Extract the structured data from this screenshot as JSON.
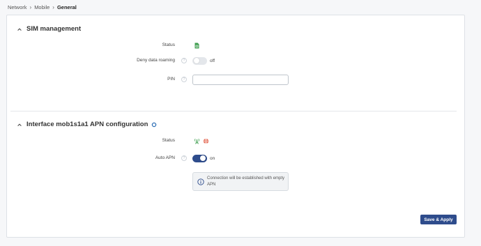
{
  "breadcrumb": {
    "items": [
      "Network",
      "Mobile",
      "General"
    ]
  },
  "sim": {
    "title": "SIM management",
    "status_label": "Status",
    "status_icon": "sim-card-icon",
    "deny_roaming_label": "Deny data roaming",
    "deny_roaming_value": "off",
    "pin_label": "PIN",
    "pin_value": ""
  },
  "apn": {
    "title": "Interface mob1s1a1 APN configuration",
    "status_label": "Status",
    "status_icons": [
      "signal-tower-icon",
      "globe-icon"
    ],
    "auto_apn_label": "Auto APN",
    "auto_apn_value": "on",
    "info_text": "Connection will be established with empty APN"
  },
  "actions": {
    "save_label": "Save & Apply"
  },
  "colors": {
    "accent": "#2e4c8c",
    "sim_green": "#3f9e4f",
    "globe_red": "#e0553d"
  }
}
